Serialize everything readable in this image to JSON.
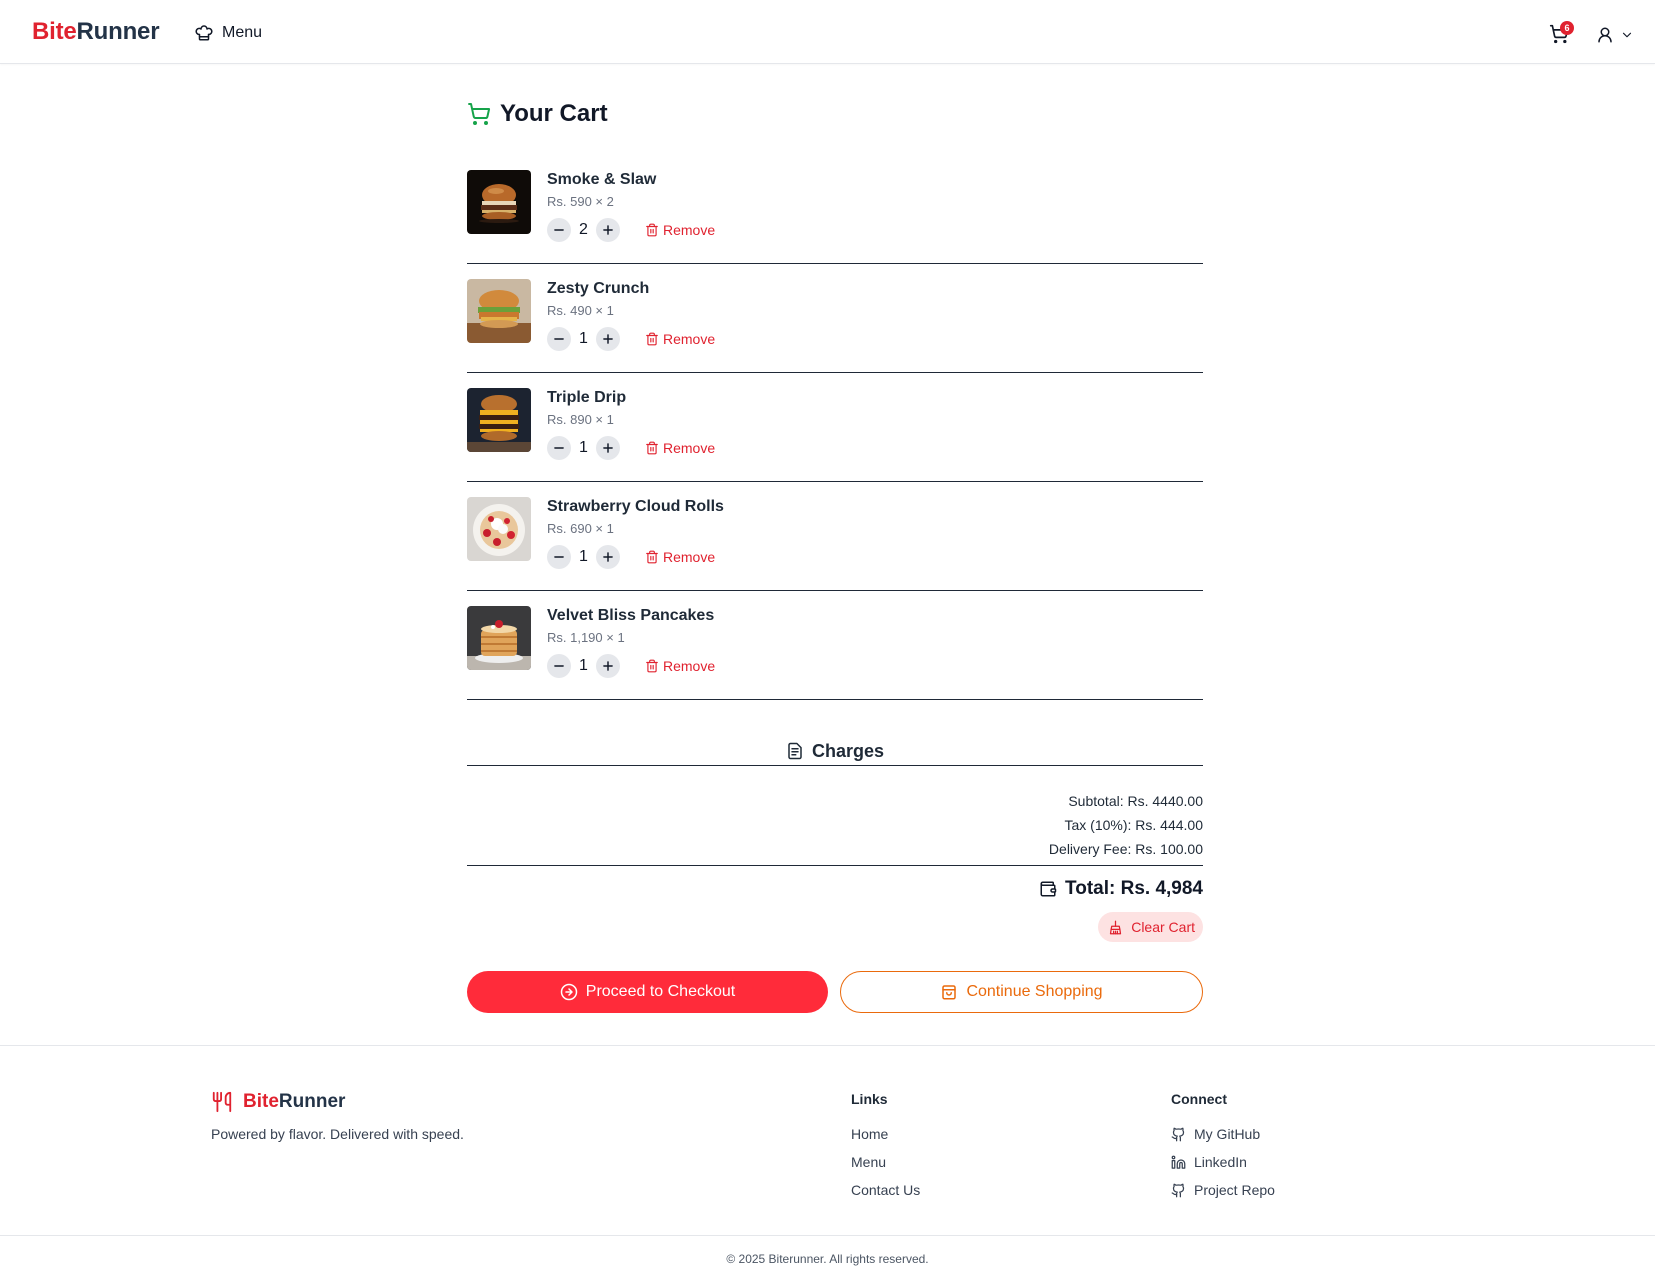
{
  "navbar": {
    "brand_part1": "Bite",
    "brand_part2": "Runner",
    "menu_label": "Menu",
    "cart_count": "6",
    "colors": {
      "accent": "#e0222f",
      "brand_dark": "#233347"
    }
  },
  "cart": {
    "title": "Your Cart",
    "items": [
      {
        "name": "Smoke & Slaw",
        "price_line": "Rs. 590 × 2",
        "qty": "2",
        "remove_label": "Remove",
        "image": "burger-dark"
      },
      {
        "name": "Zesty Crunch",
        "price_line": "Rs. 490 × 1",
        "qty": "1",
        "remove_label": "Remove",
        "image": "chicken-burger"
      },
      {
        "name": "Triple Drip",
        "price_line": "Rs. 890 × 1",
        "qty": "1",
        "remove_label": "Remove",
        "image": "triple-burger"
      },
      {
        "name": "Strawberry Cloud Rolls",
        "price_line": "Rs. 690 × 1",
        "qty": "1",
        "remove_label": "Remove",
        "image": "strawberry-rolls"
      },
      {
        "name": "Velvet Bliss Pancakes",
        "price_line": "Rs. 1,190 × 1",
        "qty": "1",
        "remove_label": "Remove",
        "image": "pancakes"
      }
    ]
  },
  "charges": {
    "title": "Charges",
    "subtotal": "Subtotal: Rs. 4440.00",
    "tax": "Tax (10%): Rs. 444.00",
    "delivery": "Delivery Fee: Rs. 100.00",
    "total": "Total: Rs. 4,984",
    "clear_label": "Clear Cart"
  },
  "actions": {
    "checkout_label": "Proceed to Checkout",
    "continue_label": "Continue Shopping",
    "colors": {
      "checkout": "#ff2b3a",
      "continue": "#ea6a0c"
    }
  },
  "footer": {
    "brand_part1": "Bite",
    "brand_part2": "Runner",
    "tagline": "Powered by flavor. Delivered with speed.",
    "links_heading": "Links",
    "links": [
      "Home",
      "Menu",
      "Contact Us"
    ],
    "connect_heading": "Connect",
    "connect": [
      {
        "label": "My GitHub",
        "icon": "github-icon"
      },
      {
        "label": "LinkedIn",
        "icon": "linkedin-icon"
      },
      {
        "label": "Project Repo",
        "icon": "github-icon"
      }
    ],
    "copyright": "© 2025 Biterunner. All rights reserved."
  }
}
